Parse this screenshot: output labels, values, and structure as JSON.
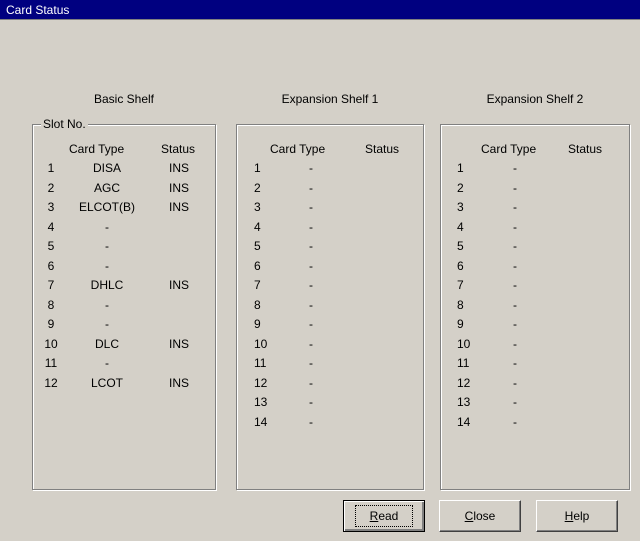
{
  "window": {
    "title": "Card Status"
  },
  "shelves": [
    {
      "title": "Basic Shelf",
      "legend": "Slot No.",
      "header_card_type": "Card Type",
      "header_status": "Status",
      "rows": [
        {
          "slot": "1",
          "card_type": "DISA",
          "status": "INS"
        },
        {
          "slot": "2",
          "card_type": "AGC",
          "status": "INS"
        },
        {
          "slot": "3",
          "card_type": "ELCOT(B)",
          "status": "INS"
        },
        {
          "slot": "4",
          "card_type": "-",
          "status": ""
        },
        {
          "slot": "5",
          "card_type": "-",
          "status": ""
        },
        {
          "slot": "6",
          "card_type": "-",
          "status": ""
        },
        {
          "slot": "7",
          "card_type": "DHLC",
          "status": "INS"
        },
        {
          "slot": "8",
          "card_type": "-",
          "status": ""
        },
        {
          "slot": "9",
          "card_type": "-",
          "status": ""
        },
        {
          "slot": "10",
          "card_type": "DLC",
          "status": "INS"
        },
        {
          "slot": "11",
          "card_type": "-",
          "status": ""
        },
        {
          "slot": "12",
          "card_type": "LCOT",
          "status": "INS"
        }
      ]
    },
    {
      "title": "Expansion Shelf 1",
      "legend": "",
      "header_card_type": "Card Type",
      "header_status": "Status",
      "rows": [
        {
          "slot": "1",
          "card_type": "-",
          "status": ""
        },
        {
          "slot": "2",
          "card_type": "-",
          "status": ""
        },
        {
          "slot": "3",
          "card_type": "-",
          "status": ""
        },
        {
          "slot": "4",
          "card_type": "-",
          "status": ""
        },
        {
          "slot": "5",
          "card_type": "-",
          "status": ""
        },
        {
          "slot": "6",
          "card_type": "-",
          "status": ""
        },
        {
          "slot": "7",
          "card_type": "-",
          "status": ""
        },
        {
          "slot": "8",
          "card_type": "-",
          "status": ""
        },
        {
          "slot": "9",
          "card_type": "-",
          "status": ""
        },
        {
          "slot": "10",
          "card_type": "-",
          "status": ""
        },
        {
          "slot": "11",
          "card_type": "-",
          "status": ""
        },
        {
          "slot": "12",
          "card_type": "-",
          "status": ""
        },
        {
          "slot": "13",
          "card_type": "-",
          "status": ""
        },
        {
          "slot": "14",
          "card_type": "-",
          "status": ""
        }
      ]
    },
    {
      "title": "Expansion Shelf 2",
      "legend": "",
      "header_card_type": "Card Type",
      "header_status": "Status",
      "rows": [
        {
          "slot": "1",
          "card_type": "-",
          "status": ""
        },
        {
          "slot": "2",
          "card_type": "-",
          "status": ""
        },
        {
          "slot": "3",
          "card_type": "-",
          "status": ""
        },
        {
          "slot": "4",
          "card_type": "-",
          "status": ""
        },
        {
          "slot": "5",
          "card_type": "-",
          "status": ""
        },
        {
          "slot": "6",
          "card_type": "-",
          "status": ""
        },
        {
          "slot": "7",
          "card_type": "-",
          "status": ""
        },
        {
          "slot": "8",
          "card_type": "-",
          "status": ""
        },
        {
          "slot": "9",
          "card_type": "-",
          "status": ""
        },
        {
          "slot": "10",
          "card_type": "-",
          "status": ""
        },
        {
          "slot": "11",
          "card_type": "-",
          "status": ""
        },
        {
          "slot": "12",
          "card_type": "-",
          "status": ""
        },
        {
          "slot": "13",
          "card_type": "-",
          "status": ""
        },
        {
          "slot": "14",
          "card_type": "-",
          "status": ""
        }
      ]
    }
  ],
  "buttons": {
    "read": {
      "mnemonic": "R",
      "rest": "ead"
    },
    "close": {
      "mnemonic": "C",
      "rest": "lose"
    },
    "help": {
      "mnemonic": "H",
      "rest": "elp"
    }
  },
  "colors": {
    "titlebar": "#000080",
    "face": "#d4d0c8"
  }
}
